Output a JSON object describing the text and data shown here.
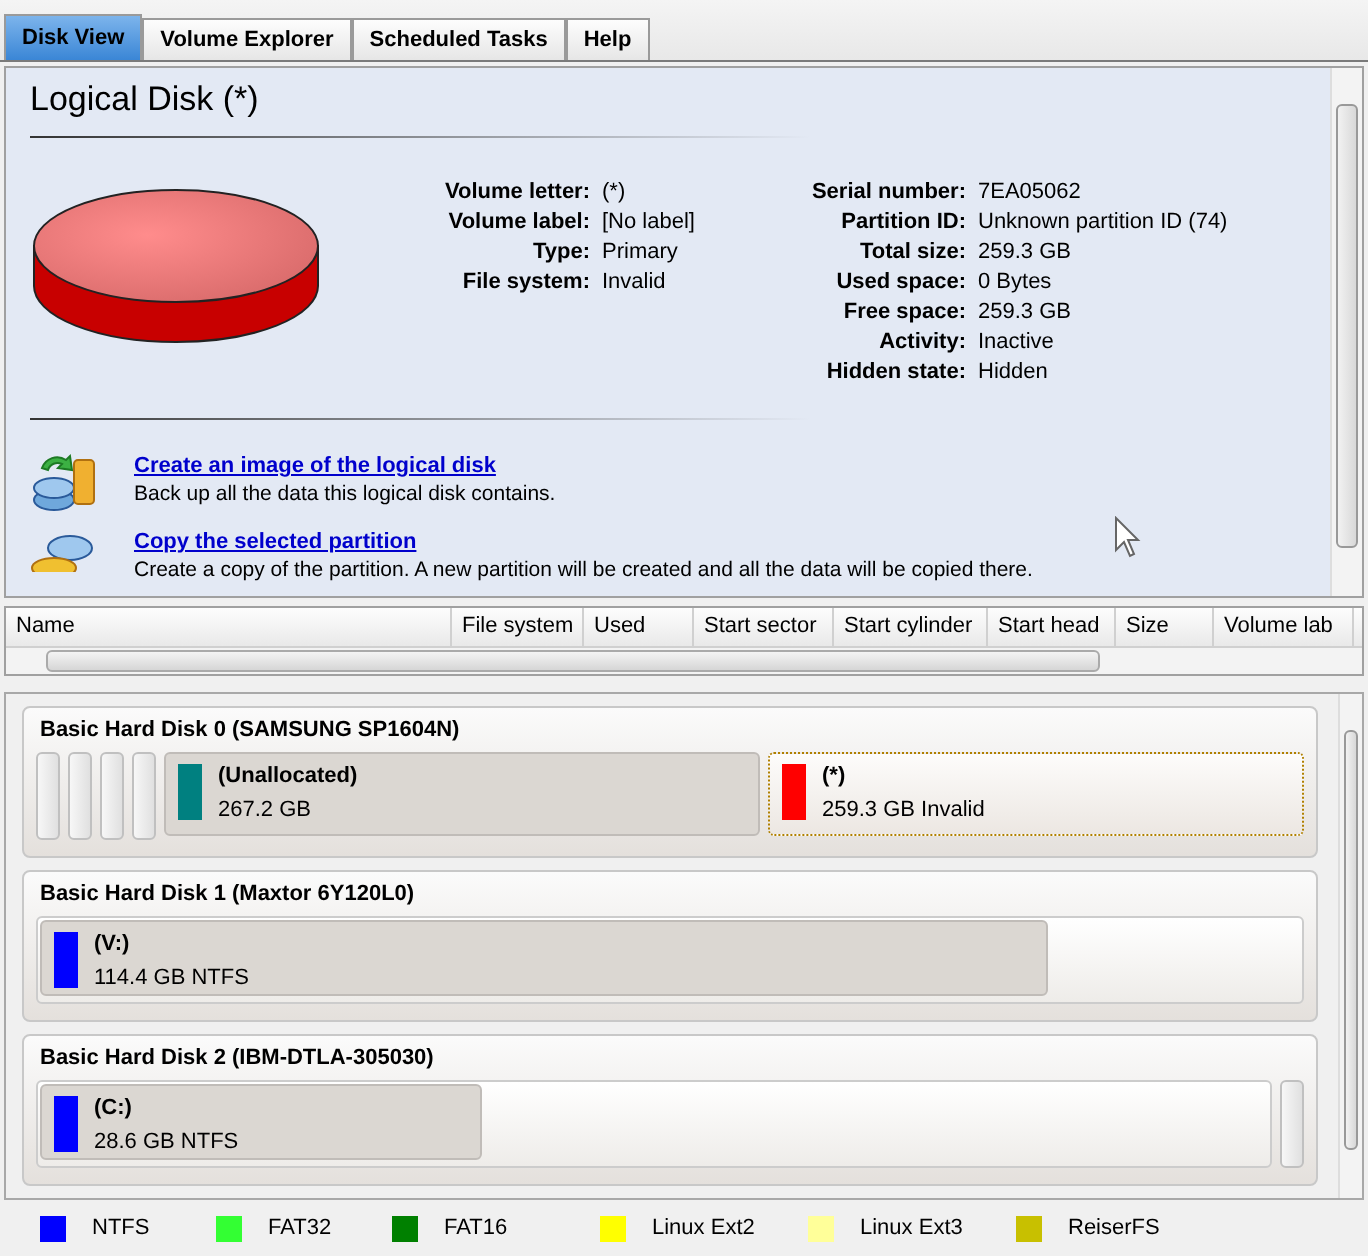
{
  "tabs": [
    {
      "label": "Disk View",
      "selected": true
    },
    {
      "label": "Volume Explorer",
      "selected": false
    },
    {
      "label": "Scheduled Tasks",
      "selected": false
    },
    {
      "label": "Help",
      "selected": false
    }
  ],
  "details": {
    "title": "Logical Disk (*)",
    "left_fields": [
      {
        "label": "Volume letter:",
        "value": "(*)"
      },
      {
        "label": "Volume label:",
        "value": "[No label]"
      },
      {
        "label": "Type:",
        "value": "Primary"
      },
      {
        "label": "File system:",
        "value": "Invalid"
      }
    ],
    "right_fields": [
      {
        "label": "Serial number:",
        "value": "7EA05062"
      },
      {
        "label": "Partition ID:",
        "value": "Unknown partition ID (74)"
      },
      {
        "label": "Total size:",
        "value": "259.3 GB"
      },
      {
        "label": "Used space:",
        "value": "0 Bytes"
      },
      {
        "label": "Free space:",
        "value": "259.3 GB"
      },
      {
        "label": "Activity:",
        "value": "Inactive"
      },
      {
        "label": "Hidden state:",
        "value": "Hidden"
      }
    ],
    "actions": [
      {
        "kind": "image",
        "title": "Create an image of the logical disk",
        "description": "Back up all the data this logical disk contains."
      },
      {
        "kind": "copy",
        "title": "Copy the selected partition",
        "description": "Create a copy of the partition. A new partition will be created and all the data will be copied there."
      }
    ]
  },
  "table": {
    "columns": [
      "Name",
      "File system",
      "Used",
      "Start sector",
      "Start cylinder",
      "Start head",
      "Size",
      "Volume lab"
    ]
  },
  "disks": [
    {
      "title": "Basic Hard Disk 0 (SAMSUNG SP1604N)",
      "partitions": [
        {
          "kind": "sliver",
          "selected": false
        },
        {
          "kind": "sliver",
          "selected": false
        },
        {
          "kind": "sliver",
          "selected": false
        },
        {
          "kind": "sliver",
          "selected": false
        },
        {
          "kind": "volume",
          "name": "(Unallocated)",
          "info": "267.2 GB",
          "color": "#008080",
          "selected": false
        },
        {
          "kind": "volume",
          "name": "(*)",
          "info": "259.3 GB Invalid",
          "color": "#ff0000",
          "selected": true
        }
      ]
    },
    {
      "title": "Basic Hard Disk 1 (Maxtor 6Y120L0)",
      "partitions": [
        {
          "kind": "container",
          "children": [
            {
              "kind": "volume",
              "name": "(V:)",
              "info": "114.4 GB NTFS",
              "color": "#0000ff",
              "selected": false
            }
          ]
        }
      ]
    },
    {
      "title": "Basic Hard Disk 2 (IBM-DTLA-305030)",
      "partitions": [
        {
          "kind": "container",
          "children": [
            {
              "kind": "volume",
              "name": "(C:)",
              "info": "28.6 GB NTFS",
              "color": "#0000ff",
              "selected": false
            }
          ]
        },
        {
          "kind": "sliver",
          "selected": false
        }
      ]
    }
  ],
  "legend": [
    {
      "label": "NTFS",
      "color": "#0000ff"
    },
    {
      "label": "FAT32",
      "color": "#33ff33"
    },
    {
      "label": "FAT16",
      "color": "#008000"
    },
    {
      "label": "Linux Ext2",
      "color": "#ffff00"
    },
    {
      "label": "Linux Ext3",
      "color": "#ffff99"
    },
    {
      "label": "ReiserFS",
      "color": "#c8c000"
    }
  ]
}
